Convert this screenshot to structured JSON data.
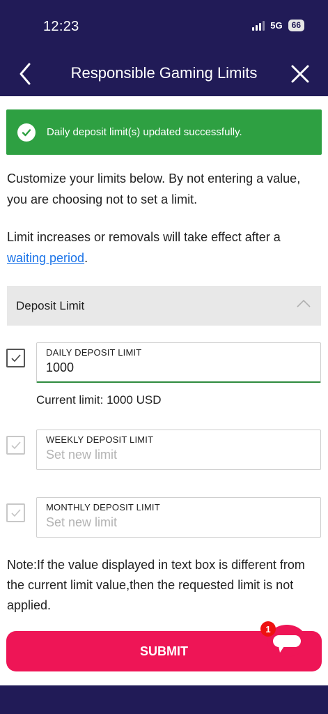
{
  "status_bar": {
    "time": "12:23",
    "network": "5G",
    "battery": "66"
  },
  "nav": {
    "title": "Responsible Gaming Limits"
  },
  "alert": {
    "message": "Daily deposit limit(s) updated successfully."
  },
  "intro": {
    "line1": "Customize your limits below. By not entering a value, you are choosing not to set a limit.",
    "line2_prefix": "Limit increases or removals will take effect after a",
    "line2_link": "waiting period",
    "line2_suffix": "."
  },
  "section": {
    "title": "Deposit Limit"
  },
  "limits": {
    "daily": {
      "label": "DAILY DEPOSIT LIMIT",
      "value": "1000",
      "current": "Current limit: 1000 USD",
      "checked": true
    },
    "weekly": {
      "label": "WEEKLY DEPOSIT LIMIT",
      "placeholder": "Set new limit",
      "checked": true
    },
    "monthly": {
      "label": "MONTHLY DEPOSIT LIMIT",
      "placeholder": "Set new limit",
      "checked": true
    }
  },
  "note": "Note:If the value displayed in text box is different from the current limit value,then the requested limit is not applied.",
  "submit": {
    "label": "SUBMIT"
  },
  "chat": {
    "badge": "1"
  },
  "colors": {
    "header": "#211b57",
    "success": "#2ea042",
    "submit": "#ee1556",
    "link": "#1a73e8"
  }
}
